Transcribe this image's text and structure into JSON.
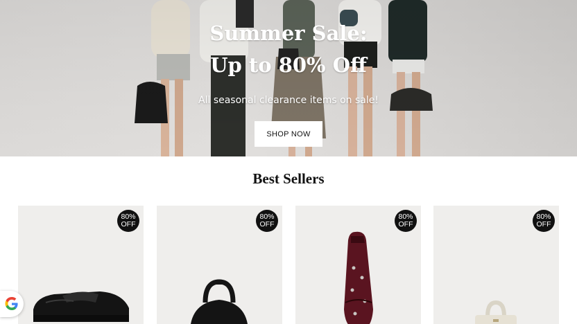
{
  "hero": {
    "title_line1": "Summer Sale:",
    "title_line2": "Up to 80% Off",
    "subtitle": "All seasonal clearance items on sale!",
    "cta_label": "SHOP NOW"
  },
  "best_sellers": {
    "title": "Best Sellers",
    "products": [
      {
        "badge_line1": "80%",
        "badge_line2": "OFF",
        "icon": "loafer-shoe-icon"
      },
      {
        "badge_line1": "80%",
        "badge_line2": "OFF",
        "icon": "handbag-icon"
      },
      {
        "badge_line1": "80%",
        "badge_line2": "OFF",
        "icon": "ballet-flat-icon"
      },
      {
        "badge_line1": "80%",
        "badge_line2": "OFF",
        "icon": "handbag-icon"
      }
    ]
  },
  "widgets": {
    "google_icon": "google-icon"
  },
  "colors": {
    "badge_bg": "#111111",
    "card_bg": "#efeeec",
    "hero_bg": "#dcdad8",
    "burgundy": "#5a1420"
  }
}
